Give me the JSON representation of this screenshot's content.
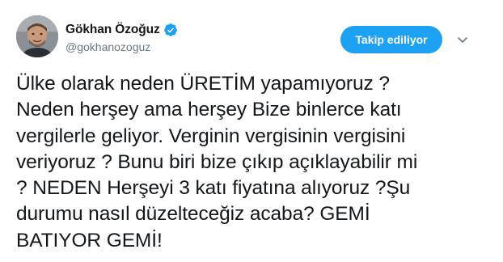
{
  "user": {
    "display_name": "Gökhan Özoğuz",
    "handle": "@gokhanozoguz",
    "verified": true,
    "verified_color": "#1da1f2"
  },
  "actions": {
    "follow_label": "Takip ediliyor",
    "follow_color": "#1da1f2",
    "more_icon": "chevron-down-icon"
  },
  "tweet": {
    "text": "Ülke olarak neden ÜRETİM yapamıyoruz ?\nNeden herşey ama herşey Bize binlerce katı\nvergilerle geliyor. Verginin vergisinin vergisini\nveriyoruz ? Bunu biri bize çıkıp açıklayabilir mi\n? NEDEN Herşeyi 3 katı fiyatına alıyoruz ?Şu\ndurumu nasıl düzelteceğiz acaba? GEMİ\nBATIYOR GEMİ!"
  }
}
